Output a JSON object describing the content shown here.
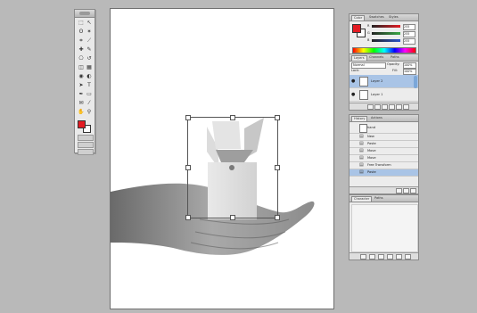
{
  "tools": {
    "icons": [
      "marquee-icon",
      "move-icon",
      "lasso-icon",
      "magic-wand-icon",
      "crop-icon",
      "slice-icon",
      "healing-brush-icon",
      "brush-icon",
      "clone-stamp-icon",
      "history-brush-icon",
      "eraser-icon",
      "gradient-icon",
      "blur-icon",
      "dodge-icon",
      "path-select-icon",
      "type-icon",
      "pen-icon",
      "shape-icon",
      "notes-icon",
      "eyedropper-icon",
      "hand-icon",
      "zoom-icon"
    ],
    "foreground_color": "#e31b23",
    "background_color": "#ffffff"
  },
  "color_panel": {
    "tabs": [
      "Color",
      "Swatches",
      "Styles"
    ],
    "channels": [
      "R",
      "G",
      "B"
    ],
    "values": [
      "255",
      "255",
      "255"
    ],
    "channel_colors": [
      "#e31b23",
      "#39a845",
      "#2b55c9"
    ]
  },
  "layers_panel": {
    "tabs": [
      "Layers",
      "Channels",
      "Paths"
    ],
    "blend_mode": "Normal",
    "opacity_label": "Opacity:",
    "opacity": "100%",
    "lock_label": "Lock:",
    "fill_label": "Fill:",
    "fill": "100%",
    "layers": [
      {
        "name": "Layer 2",
        "selected": true
      },
      {
        "name": "Layer 1",
        "selected": false
      }
    ]
  },
  "history_panel": {
    "tabs": [
      "History",
      "Actions"
    ],
    "snapshot": "hand",
    "steps": [
      {
        "label": "New",
        "selected": false
      },
      {
        "label": "Paste",
        "selected": false
      },
      {
        "label": "Move",
        "selected": false
      },
      {
        "label": "Move",
        "selected": false
      },
      {
        "label": "Free Transform",
        "selected": false
      },
      {
        "label": "Paste",
        "selected": true
      }
    ]
  },
  "browser_panel": {
    "tabs": [
      "Character",
      "Paths"
    ]
  }
}
